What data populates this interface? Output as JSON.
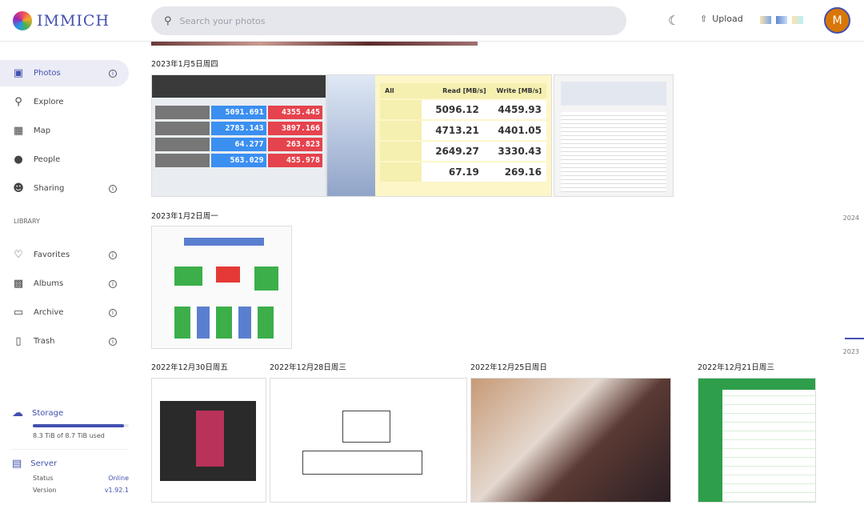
{
  "app": {
    "name": "IMMICH"
  },
  "search": {
    "placeholder": "Search your photos"
  },
  "header": {
    "upload_label": "Upload",
    "avatar_initial": "M"
  },
  "sidebar": {
    "items": [
      {
        "label": "Photos",
        "icon": "photos-icon",
        "info": true,
        "active": true
      },
      {
        "label": "Explore",
        "icon": "search-icon"
      },
      {
        "label": "Map",
        "icon": "map-icon"
      },
      {
        "label": "People",
        "icon": "person-icon"
      },
      {
        "label": "Sharing",
        "icon": "sharing-icon",
        "info": true
      }
    ],
    "library_heading": "LIBRARY",
    "library": [
      {
        "label": "Favorites",
        "icon": "heart-icon",
        "info": true
      },
      {
        "label": "Albums",
        "icon": "albums-icon",
        "info": true
      },
      {
        "label": "Archive",
        "icon": "archive-icon",
        "info": true
      },
      {
        "label": "Trash",
        "icon": "trash-icon",
        "info": true
      }
    ],
    "storage": {
      "title": "Storage",
      "used_text": "8.3 TiB of 8.7 TiB used",
      "used_percent": 95.4
    },
    "server": {
      "title": "Server",
      "status_label": "Status",
      "status": "Online",
      "version_label": "Version",
      "version": "v1.92.1"
    }
  },
  "timeline": {
    "groups": [
      {
        "date": "2023年1月5日周四"
      },
      {
        "date": "2023年1月2日周一"
      },
      {
        "date": "2022年12月30日周五"
      },
      {
        "date": "2022年12月28日周三"
      },
      {
        "date": "2022年12月25日周日"
      },
      {
        "date": "2022年12月21日周三"
      }
    ],
    "txbench": {
      "read": [
        "5091.691",
        "2783.143",
        "64.277",
        "563.029"
      ],
      "write": [
        "4355.445",
        "3897.166",
        "263.823",
        "455.978"
      ]
    },
    "cdm": {
      "read_header": "Read [MB/s]",
      "write_header": "Write [MB/s]",
      "read": [
        "5096.12",
        "4713.21",
        "2649.27",
        "67.19"
      ],
      "write": [
        "4459.93",
        "4401.05",
        "3330.43",
        "269.16"
      ]
    },
    "scrubber": [
      "2024",
      "2023"
    ]
  },
  "colors": {
    "accent": "#4250af",
    "avatar": "#d97706"
  }
}
